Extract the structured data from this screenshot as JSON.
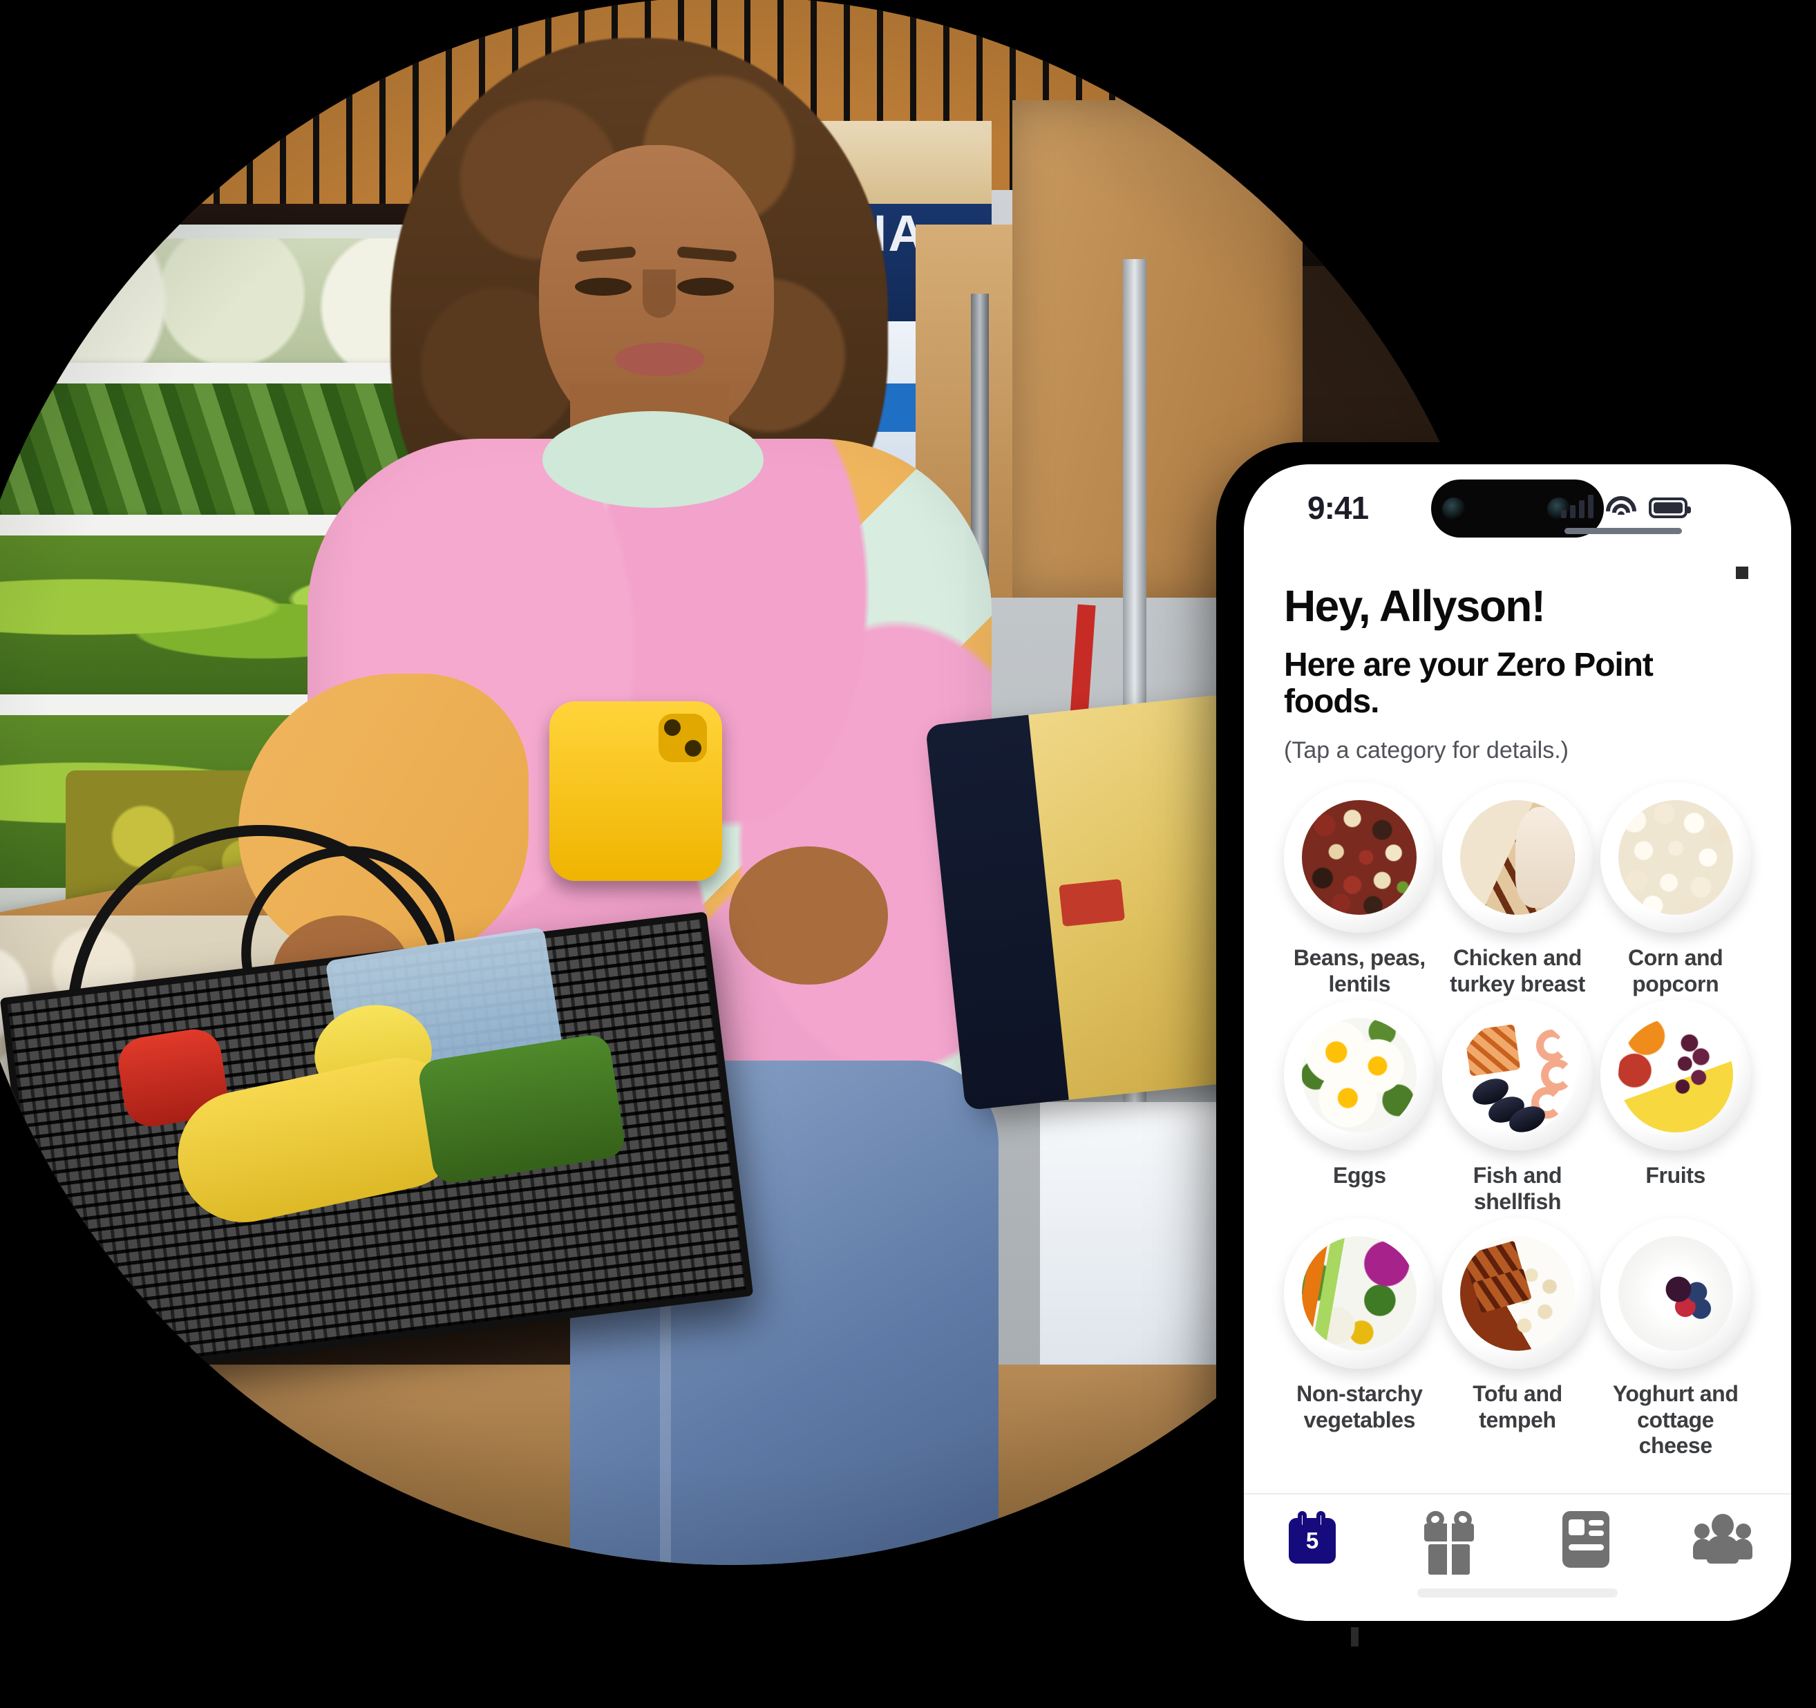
{
  "brand": {
    "navy": "#160b7d",
    "icon_gray": "#717171",
    "text_dark": "#3b3d40"
  },
  "phone": {
    "status_bar": {
      "clock": "9:41",
      "signal_icon": "cellular-bars-icon",
      "wifi_icon": "wifi-icon",
      "battery_icon": "battery-full-icon"
    },
    "screen": {
      "greeting": "Hey, Allyson!",
      "subtitle": "Here are your Zero Point foods.",
      "hint": "(Tap a category for details.)",
      "categories": [
        {
          "label": "Beans, peas, lentils",
          "image": "plate-beans-peas-lentils"
        },
        {
          "label": "Chicken and turkey breast",
          "image": "plate-chicken-turkey-breast"
        },
        {
          "label": "Corn and popcorn",
          "image": "plate-corn-popcorn"
        },
        {
          "label": "Eggs",
          "image": "plate-eggs"
        },
        {
          "label": "Fish and shellfish",
          "image": "plate-fish-shellfish"
        },
        {
          "label": "Fruits",
          "image": "plate-fruits"
        },
        {
          "label": "Non-starchy vegetables",
          "image": "plate-non-starchy-vegetables"
        },
        {
          "label": "Tofu and tempeh",
          "image": "plate-tofu-tempeh"
        },
        {
          "label": "Yoghurt and cottage cheese",
          "image": "plate-yoghurt-cottage-cheese"
        }
      ]
    },
    "tab_bar": [
      {
        "name": "calendar-tab",
        "icon": "calendar-icon",
        "badge": "5",
        "active": true
      },
      {
        "name": "rewards-tab",
        "icon": "gift-icon",
        "active": false
      },
      {
        "name": "articles-tab",
        "icon": "article-icon",
        "active": false
      },
      {
        "name": "community-tab",
        "icon": "people-icon",
        "active": false
      }
    ]
  },
  "photo": {
    "alt": "woman-shopping-in-grocery-store-holding-phone-and-basket"
  }
}
